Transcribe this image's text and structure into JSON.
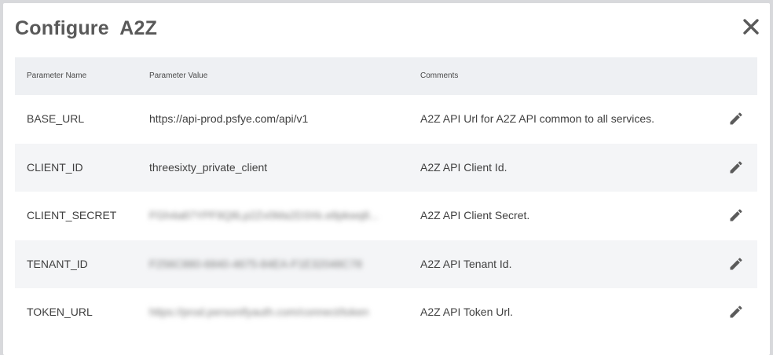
{
  "modal": {
    "title": "Configure  A2Z"
  },
  "table": {
    "headers": {
      "name": "Parameter Name",
      "value": "Parameter Value",
      "comments": "Comments"
    },
    "rows": [
      {
        "name": "BASE_URL",
        "value": "https://api-prod.psfye.com/api/v1",
        "comment": "A2Z API Url for A2Z API common to all services.",
        "masked": false
      },
      {
        "name": "CLIENT_ID",
        "value": "threesixty_private_client",
        "comment": "A2Z API Client Id.",
        "masked": false
      },
      {
        "name": "CLIENT_SECRET",
        "value": "FGh4a87YPF9Q8Lp2Zv0Ma2D3Xk.e8pkwq8...",
        "comment": "A2Z API Client Secret.",
        "masked": true
      },
      {
        "name": "TENANT_ID",
        "value": "F256C880-6840-4675-84EA-F1E32048C78",
        "comment": "A2Z API Tenant Id.",
        "masked": true
      },
      {
        "name": "TOKEN_URL",
        "value": "https://prod.personifyauth.com/connect/token",
        "comment": "A2Z API Token Url.",
        "masked": true
      }
    ]
  },
  "icons": {
    "close": "close-icon",
    "edit": "pencil-icon"
  }
}
